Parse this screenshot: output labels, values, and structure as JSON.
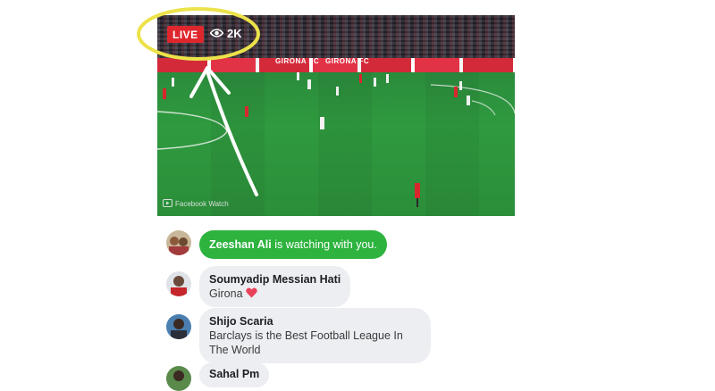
{
  "video": {
    "live_label": "LIVE",
    "viewer_count": "2K",
    "board_text": "GIRONA FC",
    "watermark": "Facebook Watch"
  },
  "comments": [
    {
      "name": "Zeeshan Ali",
      "text": "is watching with you.",
      "type": "join",
      "color": "#2db33e"
    },
    {
      "name": "Soumyadip Messian Hati",
      "text": "Girona",
      "emoji": "heart"
    },
    {
      "name": "Shijo Scaria",
      "text": "Barclays is the Best Football League In The World"
    },
    {
      "name": "Sahal Pm"
    }
  ],
  "colors": {
    "live": "#e0262d",
    "highlight_circle": "#ece24a",
    "join_bubble": "#2db33e"
  }
}
